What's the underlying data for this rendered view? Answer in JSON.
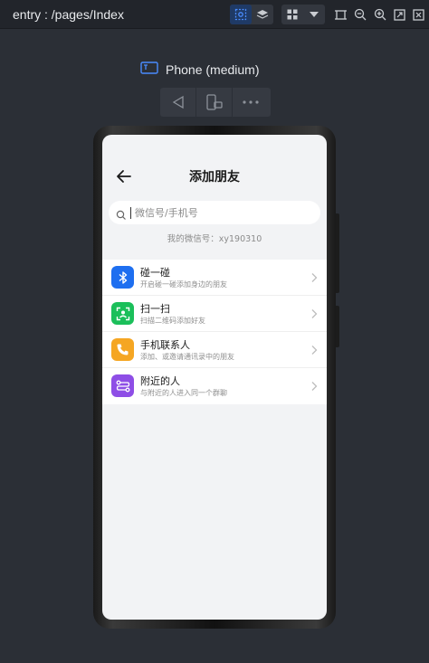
{
  "toolbar": {
    "route": "entry : /pages/Index",
    "icons": [
      "inspect-icon",
      "layers-icon",
      "grid-icon",
      "dropdown-icon",
      "crop-icon",
      "zoom-out-icon",
      "zoom-in-icon",
      "fit-icon",
      "close-icon"
    ]
  },
  "device": {
    "name": "Phone (medium)"
  },
  "app": {
    "title": "添加朋友",
    "search_placeholder": "微信号/手机号",
    "my_id": "我的微信号：xy190310",
    "items": [
      {
        "title": "碰一碰",
        "subtitle": "开启碰一碰添加身边的朋友",
        "icon": "bluetooth-icon",
        "color": "#1e6ff0"
      },
      {
        "title": "扫一扫",
        "subtitle": "扫描二维码添加好友",
        "icon": "scan-icon",
        "color": "#1bbf5a"
      },
      {
        "title": "手机联系人",
        "subtitle": "添加、或邀请通讯录中的朋友",
        "icon": "phone-icon",
        "color": "#f5a623"
      },
      {
        "title": "附近的人",
        "subtitle": "与附近的人进入同一个群聊",
        "icon": "nearby-icon",
        "color": "#8e4ee6"
      }
    ]
  }
}
